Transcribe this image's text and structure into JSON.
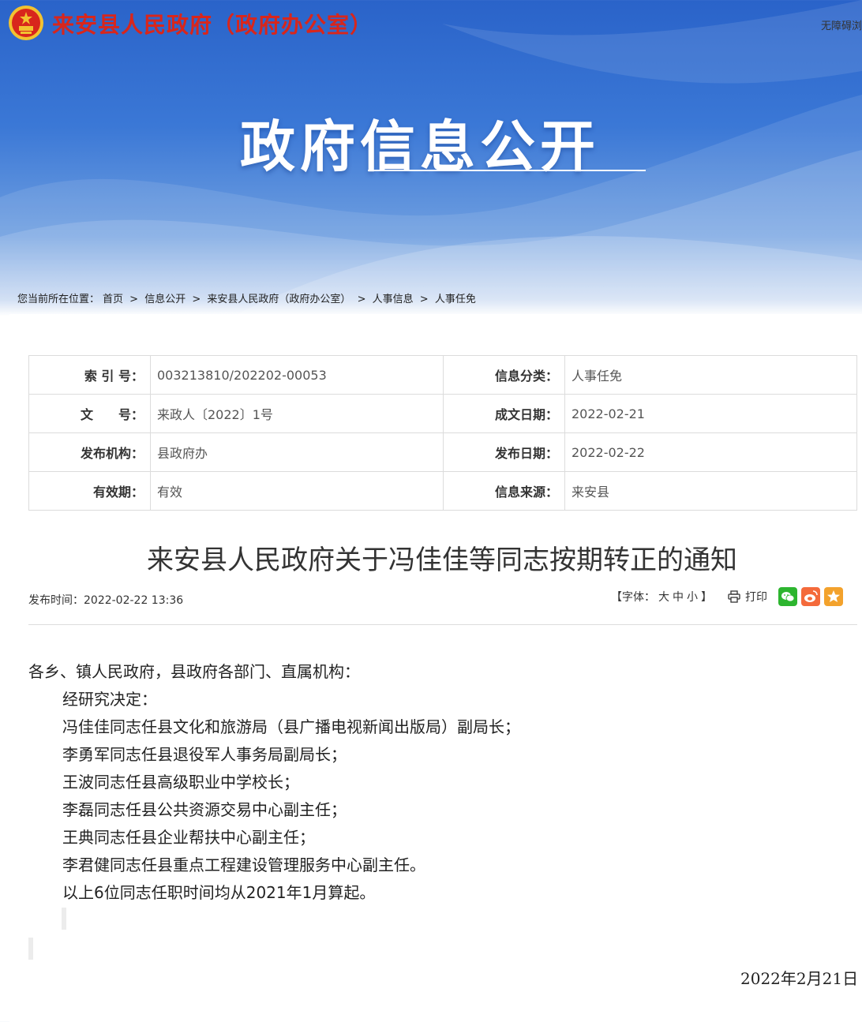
{
  "header": {
    "site_title": "来安县人民政府（政府办公室）",
    "accessibility": "无障碍浏",
    "banner_title": "政府信息公开"
  },
  "breadcrumb": {
    "prefix": "您当前所在位置：",
    "items": [
      "首页",
      "信息公开",
      "来安县人民政府（政府办公室）",
      "人事信息",
      "人事任免"
    ],
    "separator": ">"
  },
  "meta": {
    "rows": [
      {
        "k1": "索 引 号：",
        "v1": "003213810/202202-00053",
        "k2": "信息分类：",
        "v2": "人事任免"
      },
      {
        "k1": "文　　号：",
        "v1": "来政人〔2022〕1号",
        "k2": "成文日期：",
        "v2": "2022-02-21"
      },
      {
        "k1": "发布机构：",
        "v1": "县政府办",
        "k2": "发布日期：",
        "v2": "2022-02-22"
      },
      {
        "k1": "有效期：",
        "v1": "有效",
        "k2": "信息来源：",
        "v2": "来安县"
      }
    ]
  },
  "article": {
    "title": "来安县人民政府关于冯佳佳等同志按期转正的通知",
    "publish_time": "发布时间：2022-02-22 13:36",
    "tools": {
      "font_prefix": "【字体：",
      "font_large": "大",
      "font_medium": "中",
      "font_small": "小",
      "font_suffix": "】",
      "print": "打印"
    },
    "salutation": "各乡、镇人民政府，县政府各部门、直属机构：",
    "paragraphs": [
      "经研究决定：",
      "冯佳佳同志任县文化和旅游局（县广播电视新闻出版局）副局长；",
      "李勇军同志任县退役军人事务局副局长；",
      "王波同志任县高级职业中学校长；",
      "李磊同志任县公共资源交易中心副主任；",
      "王典同志任县企业帮扶中心副主任；",
      "李君健同志任县重点工程建设管理服务中心副主任。",
      "以上6位同志任职时间均从2021年1月算起。"
    ],
    "sign_date": "2022年2月21日"
  },
  "colors": {
    "site_title": "#d8261c",
    "banner_blue": "#2a63c9",
    "wechat": "#2db52f",
    "weibo": "#f46a3b",
    "favorite": "#f3a22c"
  },
  "icons": [
    "national-emblem-icon",
    "printer-icon",
    "wechat-icon",
    "weibo-icon",
    "star-icon"
  ]
}
